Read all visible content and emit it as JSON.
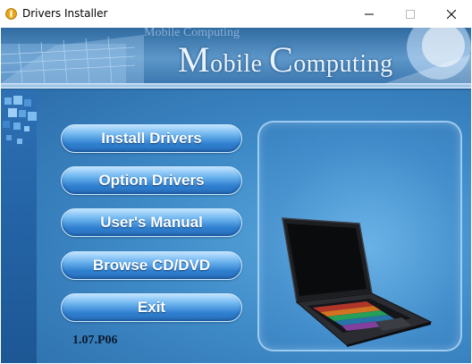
{
  "window": {
    "title": "Drivers Installer",
    "controls": {
      "minimize_icon": "minimize-icon",
      "maximize_icon": "maximize-icon",
      "close_icon": "close-icon"
    }
  },
  "banner": {
    "watermark": "Mobile Computing",
    "title_first_letter": "M",
    "title_part1": "obile ",
    "title_second_letter": "C",
    "title_part2": "omputing"
  },
  "menu": {
    "install_drivers": "Install Drivers",
    "option_drivers": "Option Drivers",
    "users_manual": "User's Manual",
    "browse_cd_dvd": "Browse CD/DVD",
    "exit": "Exit"
  },
  "version": "1.07.P06",
  "image": {
    "icon": "laptop-image"
  },
  "colors": {
    "button": "#3d8fd8",
    "background": "#3f8ccb",
    "banner_text": "#eaf4ff"
  }
}
